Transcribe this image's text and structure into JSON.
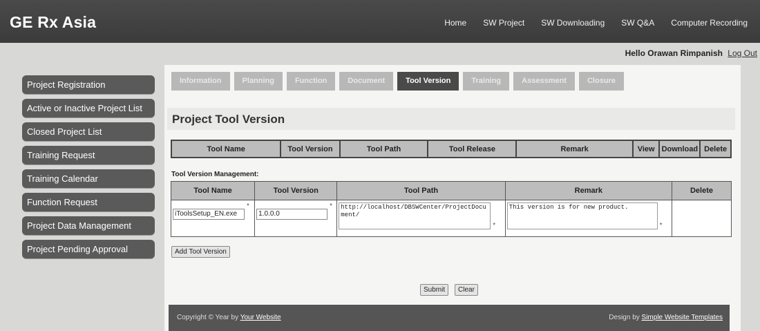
{
  "header": {
    "brand": "GE Rx Asia",
    "nav": [
      "Home",
      "SW Project",
      "SW Downloading",
      "SW Q&A",
      "Computer Recording"
    ],
    "greeting": "Hello Orawan Rimpanish",
    "logout": "Log Out"
  },
  "sidebar": {
    "items": [
      {
        "label": "Project Registration"
      },
      {
        "label": "Active or Inactive Project List"
      },
      {
        "label": "Closed Project List"
      },
      {
        "label": "Training Request"
      },
      {
        "label": "Training Calendar"
      },
      {
        "label": "Function Request"
      },
      {
        "label": "Project Data Management"
      },
      {
        "label": "Project Pending Approval"
      }
    ]
  },
  "tabs": [
    "Information",
    "Planning",
    "Function",
    "Document",
    "Tool Version",
    "Training",
    "Assessment",
    "Closure"
  ],
  "page": {
    "title": "Project Tool Version"
  },
  "list_table": {
    "headers": [
      "Tool Name",
      "Tool Version",
      "Tool Path",
      "Tool Release",
      "Remark",
      "View",
      "Download",
      "Delete"
    ]
  },
  "management": {
    "label": "Tool Version Management:",
    "headers": [
      "Tool Name",
      "Tool Version",
      "Tool Path",
      "Remark",
      "Delete"
    ],
    "row": {
      "tool_name": "iToolsSetup_EN.exe",
      "tool_version": "1.0.0.0",
      "tool_path_line1": "http://localhost/DBSWCenter/ProjectDocu",
      "tool_path_line2": "ment/",
      "remark": "This version is for new product.",
      "required_mark": "*"
    }
  },
  "buttons": {
    "add": "Add Tool Version",
    "submit": "Submit",
    "clear": "Clear"
  },
  "footer": {
    "copyright_prefix": "Copyright © Year by ",
    "copyright_link": "Your Website",
    "design_prefix": "Design by ",
    "design_link": "Simple Website Templates"
  }
}
